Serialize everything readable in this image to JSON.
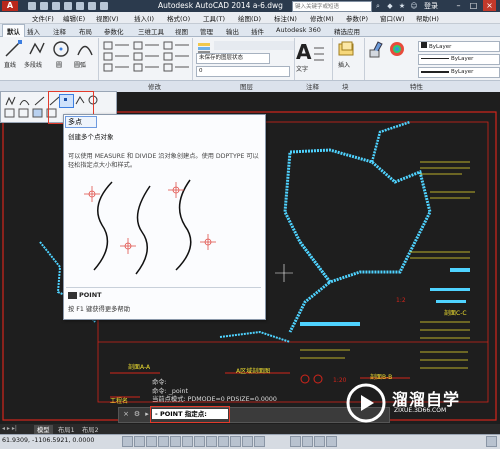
{
  "titlebar": {
    "logo": "A",
    "title": "Autodesk AutoCAD 2014    a-6.dwg",
    "search_placeholder": "键入关键字或短语",
    "login": "登录",
    "minimize": "–",
    "maximize": "□",
    "close": "×"
  },
  "menu": [
    "文件(F)",
    "编辑(E)",
    "视图(V)",
    "插入(I)",
    "格式(O)",
    "工具(T)",
    "绘图(D)",
    "标注(N)",
    "修改(M)",
    "参数(P)",
    "窗口(W)",
    "帮助(H)"
  ],
  "ribbon_tabs": [
    "默认",
    "插入",
    "注释",
    "布局",
    "参数化",
    "三维工具",
    "视图",
    "管理",
    "输出",
    "插件",
    "Autodesk 360",
    "精选应用"
  ],
  "ribbon": {
    "draw_tools": [
      "直线",
      "多段线",
      "圆",
      "圆弧"
    ],
    "text_tool": "文字",
    "annotation_label": "注释",
    "insert_label": "插入",
    "layer_dropdown": "未保存的图层状态",
    "layer_state": "0",
    "bylayer": [
      "ByLayer",
      "ByLayer",
      "ByLayer"
    ],
    "panels": [
      "修改",
      "图层",
      "注释",
      "块",
      "特性"
    ]
  },
  "tooltip": {
    "title": "多点",
    "summary": "创建多个点对象",
    "description": "可以使用 MEASURE 和 DIVIDE 沿对象创建点。使用 DDPTYPE 可以轻松指定点大小和样式。",
    "command_name": "POINT",
    "help": "按 F1 键获得更多帮助"
  },
  "drawing_labels": {
    "l1": "剖面A-A",
    "l2": "A区域剖面图",
    "l3": "剖面B-B",
    "l4": "剖面C-C",
    "l5": "工程名",
    "scale1": "1:20",
    "scale2": "1:2"
  },
  "command": {
    "history": [
      "命令:",
      "命令: _point",
      "当前点模式:  PDMODE=0  PDSIZE=0.0000"
    ],
    "prompt": "- POINT 指定点:"
  },
  "layout_tabs": [
    "模型",
    "布局1",
    "布局2"
  ],
  "status": {
    "coords": "61.9309,  -1106.5921, 0.0000"
  },
  "watermark": {
    "name": "溜溜自学",
    "url": "ZIXUE.3D66.COM"
  },
  "colors": {
    "canvas": "#1e1e1e",
    "cad_red": "#d1251b",
    "cad_cyan": "#4fd3ff",
    "cad_yellow": "#f0e030",
    "highlight_red": "#e23b2c"
  }
}
